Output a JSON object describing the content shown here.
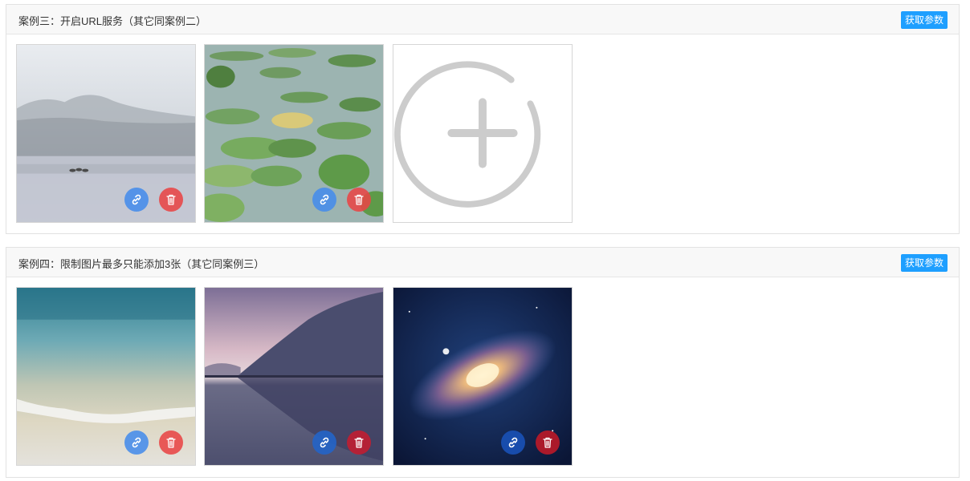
{
  "case3": {
    "title": "案例三：开启URL服务（其它同案例二）",
    "button_label": "获取参数",
    "images": [
      {
        "name": "misty-lake-image"
      },
      {
        "name": "lily-pads-image"
      }
    ]
  },
  "case4": {
    "title": "案例四：限制图片最多只能添加3张（其它同案例三）",
    "button_label": "获取参数",
    "images": [
      {
        "name": "beach-image"
      },
      {
        "name": "mountain-lake-image"
      },
      {
        "name": "galaxy-image"
      }
    ]
  },
  "colors": {
    "accent": "#1e9fff",
    "link_button": "#468ceb",
    "delete_button": "#e84646",
    "add_icon": "#cccccc"
  },
  "icons": {
    "link": "link-icon",
    "delete": "trash-icon",
    "add": "plus-circle-icon"
  }
}
